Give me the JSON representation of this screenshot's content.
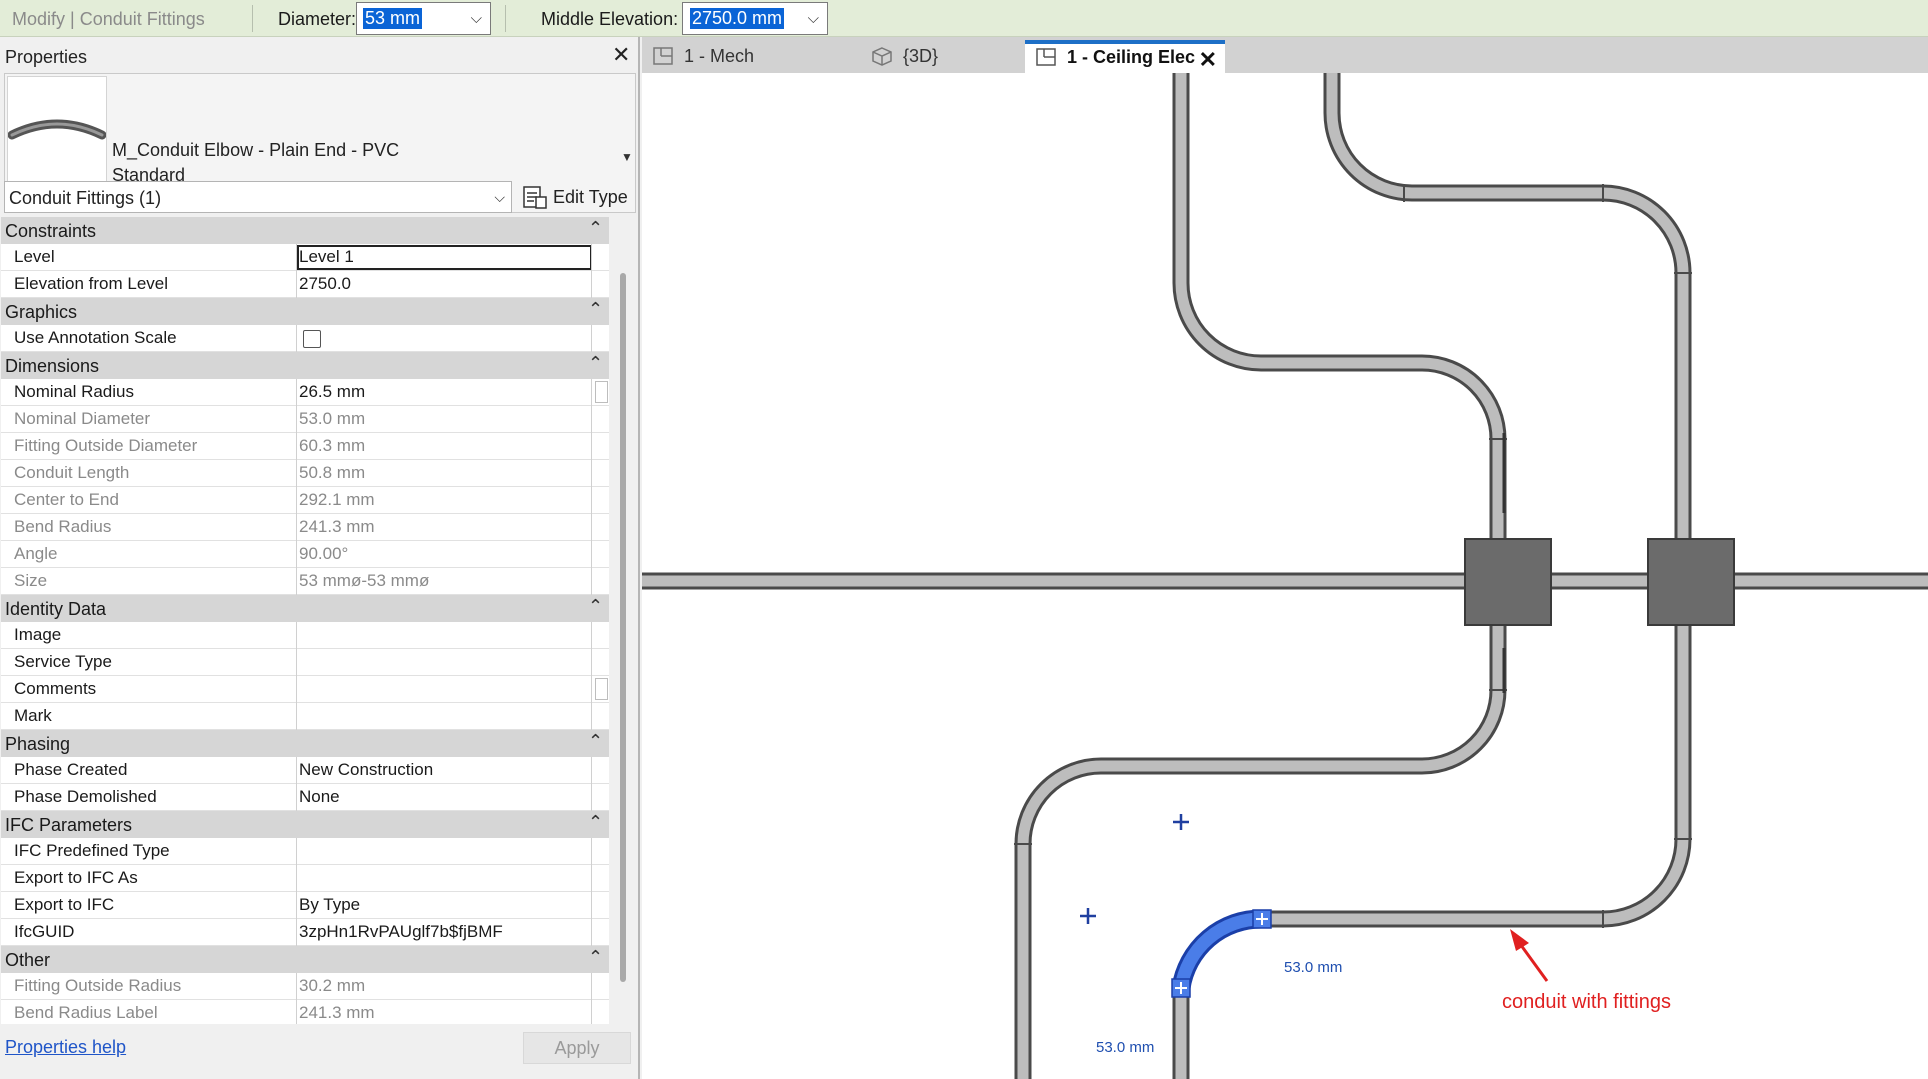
{
  "options_bar": {
    "context": "Modify | Conduit Fittings",
    "diameter_label": "Diameter:",
    "diameter_value": "53 mm",
    "middle_elevation_label": "Middle Elevation:",
    "middle_elevation_value": "2750.0 mm"
  },
  "properties": {
    "title": "Properties",
    "type_family": "M_Conduit Elbow - Plain End - PVC",
    "type_name": "Standard",
    "category_selector": "Conduit Fittings (1)",
    "edit_type_label": "Edit Type",
    "help_link": "Properties help",
    "apply_label": "Apply",
    "groups": {
      "constraints": "Constraints",
      "graphics": "Graphics",
      "dimensions": "Dimensions",
      "identity": "Identity Data",
      "phasing": "Phasing",
      "ifc": "IFC Parameters",
      "other": "Other"
    },
    "rows": {
      "level": {
        "name": "Level",
        "value": "Level 1"
      },
      "elevation_from_level": {
        "name": "Elevation from Level",
        "value": "2750.0"
      },
      "use_annotation_scale": {
        "name": "Use Annotation Scale",
        "value": ""
      },
      "nominal_radius": {
        "name": "Nominal Radius",
        "value": "26.5 mm"
      },
      "nominal_diameter": {
        "name": "Nominal Diameter",
        "value": "53.0 mm"
      },
      "fitting_outside_diameter": {
        "name": "Fitting Outside Diameter",
        "value": "60.3 mm"
      },
      "conduit_length": {
        "name": "Conduit Length",
        "value": "50.8 mm"
      },
      "center_to_end": {
        "name": "Center to End",
        "value": "292.1 mm"
      },
      "bend_radius": {
        "name": "Bend Radius",
        "value": "241.3 mm"
      },
      "angle": {
        "name": "Angle",
        "value": "90.00°"
      },
      "size": {
        "name": "Size",
        "value": "53 mmø-53 mmø"
      },
      "image": {
        "name": "Image",
        "value": ""
      },
      "service_type": {
        "name": "Service Type",
        "value": ""
      },
      "comments": {
        "name": "Comments",
        "value": ""
      },
      "mark": {
        "name": "Mark",
        "value": ""
      },
      "phase_created": {
        "name": "Phase Created",
        "value": "New Construction"
      },
      "phase_demolished": {
        "name": "Phase Demolished",
        "value": "None"
      },
      "ifc_predefined_type": {
        "name": "IFC Predefined Type",
        "value": ""
      },
      "export_to_ifc_as": {
        "name": "Export to IFC As",
        "value": ""
      },
      "export_to_ifc": {
        "name": "Export to IFC",
        "value": "By Type"
      },
      "ifc_guid": {
        "name": "IfcGUID",
        "value": "3zpHn1RvPAUglf7b$fjBMF"
      },
      "fitting_outside_radius": {
        "name": "Fitting Outside Radius",
        "value": "30.2 mm"
      },
      "bend_radius_label": {
        "name": "Bend Radius Label",
        "value": "241.3 mm"
      }
    }
  },
  "tabs": [
    {
      "label": "1 - Mech",
      "icon": "floor-plan-icon"
    },
    {
      "label": "{3D}",
      "icon": "3d-view-icon"
    },
    {
      "label": "1 - Ceiling Elec",
      "icon": "floor-plan-icon",
      "active": true
    }
  ],
  "canvas": {
    "dim_horizontal": "53.0 mm",
    "dim_vertical": "53.0 mm",
    "callout": "conduit with fittings"
  },
  "colors": {
    "options_bar_bg": "#e3edd8",
    "selection_blue": "#0a64d6",
    "selected_conduit": "#3a6ee0",
    "annotation_red": "#e02020",
    "dimension_blue": "#1f4fb0"
  }
}
